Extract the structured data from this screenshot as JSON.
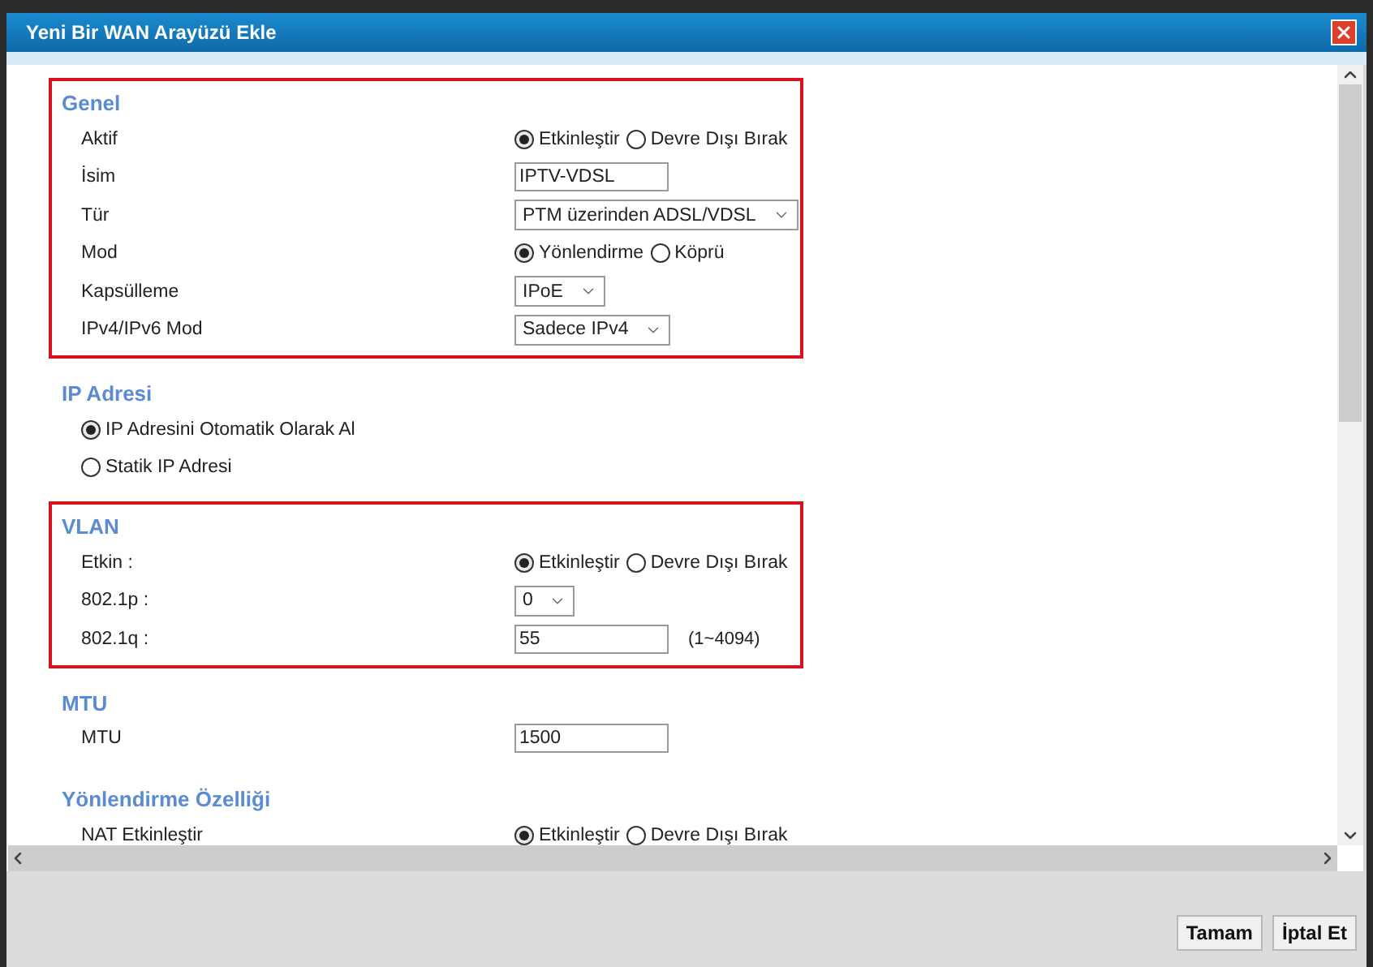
{
  "window": {
    "title": "Yeni Bir WAN Arayüzü Ekle"
  },
  "sections": [
    {
      "title": "Genel",
      "highlighted": true,
      "rows": [
        {
          "kind": "radio",
          "label": "Aktif",
          "options": [
            {
              "label": "Etkinleştir",
              "selected": true
            },
            {
              "label": "Devre Dışı Bırak",
              "selected": false
            }
          ]
        },
        {
          "kind": "text",
          "label": "İsim",
          "value": "IPTV-VDSL"
        },
        {
          "kind": "select",
          "label": "Tür",
          "value": "PTM üzerinden ADSL/VDSL"
        },
        {
          "kind": "radio",
          "label": "Mod",
          "options": [
            {
              "label": "Yönlendirme",
              "selected": true
            },
            {
              "label": "Köprü",
              "selected": false
            }
          ]
        },
        {
          "kind": "select",
          "label": "Kapsülleme",
          "value": "IPoE"
        },
        {
          "kind": "select",
          "label": "IPv4/IPv6 Mod",
          "value": "Sadece IPv4"
        }
      ]
    },
    {
      "title": "IP Adresi",
      "highlighted": false,
      "rows": [
        {
          "kind": "stack",
          "options": [
            {
              "label": "IP Adresini Otomatik Olarak Al",
              "selected": true
            },
            {
              "label": "Statik IP Adresi",
              "selected": false
            }
          ]
        }
      ]
    },
    {
      "title": "VLAN",
      "highlighted": true,
      "rows": [
        {
          "kind": "radio",
          "label": "Etkin :",
          "options": [
            {
              "label": "Etkinleştir",
              "selected": true
            },
            {
              "label": "Devre Dışı Bırak",
              "selected": false
            }
          ]
        },
        {
          "kind": "select",
          "label": "802.1p :",
          "value": "0"
        },
        {
          "kind": "text",
          "label": "802.1q :",
          "value": "55",
          "note": "(1~4094)"
        }
      ]
    },
    {
      "title": "MTU",
      "highlighted": false,
      "rows": [
        {
          "kind": "text",
          "label": "MTU",
          "value": "1500"
        }
      ]
    },
    {
      "title": "Yönlendirme Özelliği",
      "highlighted": false,
      "rows": [
        {
          "kind": "radio",
          "label": "NAT Etkinleştir",
          "options": [
            {
              "label": "Etkinleştir",
              "selected": true
            },
            {
              "label": "Devre Dışı Bırak",
              "selected": false
            }
          ]
        }
      ]
    }
  ],
  "buttons": [
    "Tamam",
    "İptal Et"
  ]
}
